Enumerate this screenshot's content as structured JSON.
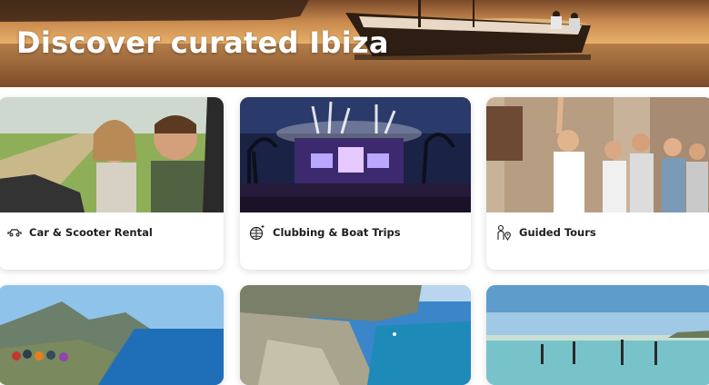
{
  "hero": {
    "title": "Discover curated Ibiza"
  },
  "cards": [
    {
      "label": "Car & Scooter Rental",
      "icon": "car-icon"
    },
    {
      "label": "Clubbing & Boat Trips",
      "icon": "disco-ball-icon"
    },
    {
      "label": "Guided Tours",
      "icon": "guide-location-icon"
    },
    {
      "label": "",
      "icon": ""
    },
    {
      "label": "",
      "icon": ""
    },
    {
      "label": "",
      "icon": ""
    }
  ]
}
